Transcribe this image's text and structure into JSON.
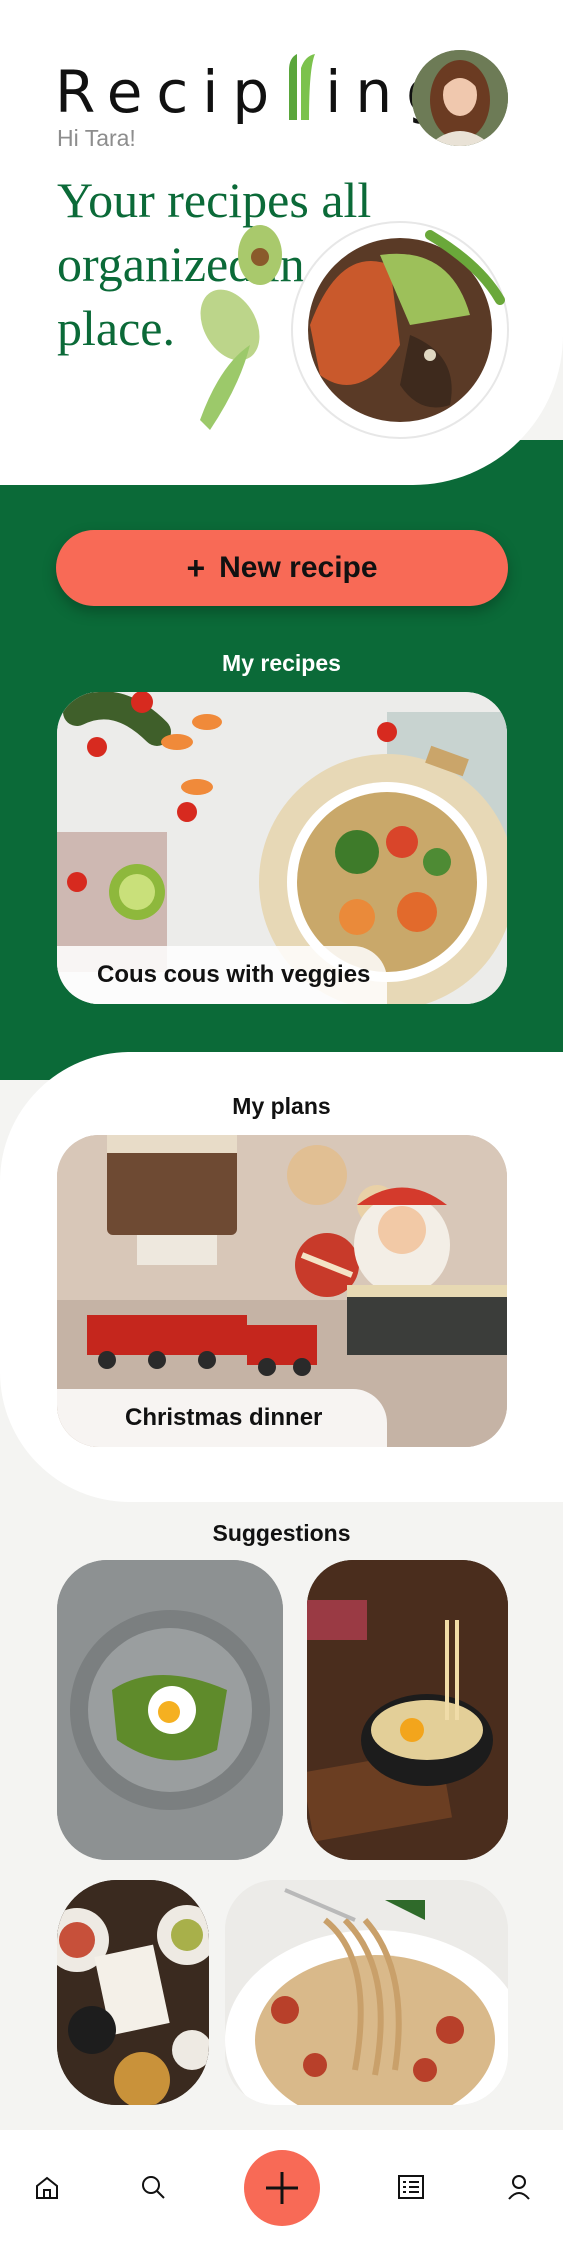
{
  "app": {
    "logo_text_left": "Recip",
    "logo_text_right": "ing",
    "greeting": "Hi Tara!",
    "hero_title": "Your recipes all organized in one place."
  },
  "actions": {
    "new_recipe_label": "New recipe",
    "plus_symbol": "+"
  },
  "sections": {
    "my_recipes": "My recipes",
    "my_plans": "My plans",
    "suggestions": "Suggestions"
  },
  "cards": {
    "recipe": {
      "caption": "Cous cous with veggies"
    },
    "plan": {
      "caption": "Christmas dinner"
    }
  },
  "nav": {
    "items": [
      "home-icon",
      "search-icon",
      "add-icon",
      "list-icon",
      "profile-icon"
    ]
  },
  "colors": {
    "brand_green": "#0b6a38",
    "accent_coral": "#f86a56",
    "background": "#f4f4f2"
  }
}
